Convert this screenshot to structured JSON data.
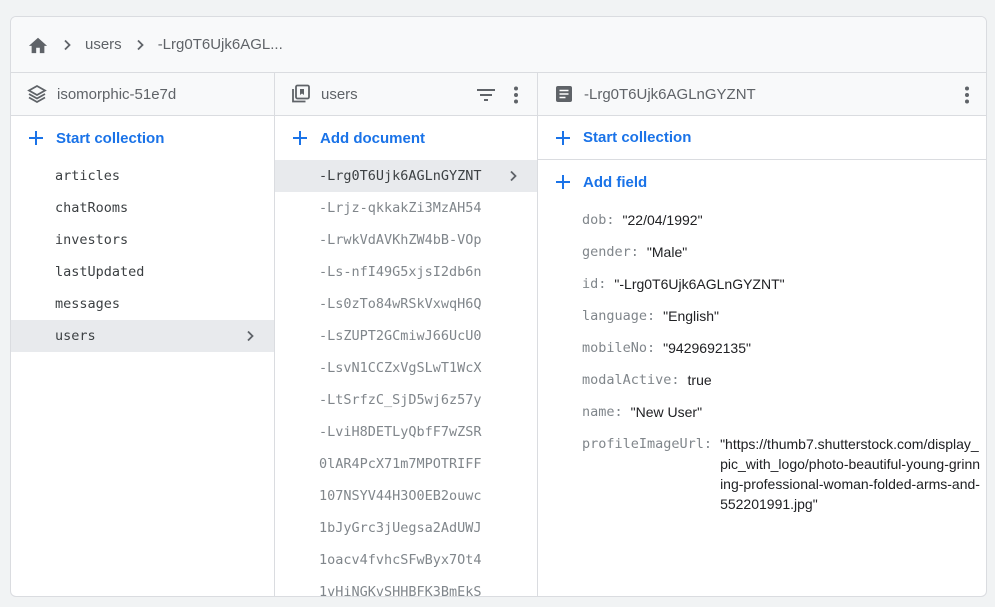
{
  "breadcrumb": {
    "items": [
      "users",
      "-Lrg0T6Ujk6AGL..."
    ]
  },
  "projects_panel": {
    "title": "isomorphic-51e7d",
    "add_label": "Start collection",
    "collections": [
      {
        "label": "articles"
      },
      {
        "label": "chatRooms"
      },
      {
        "label": "investors"
      },
      {
        "label": "lastUpdated"
      },
      {
        "label": "messages"
      },
      {
        "label": "users",
        "selected": true
      }
    ]
  },
  "collection_panel": {
    "title": "users",
    "add_label": "Add document",
    "documents": [
      {
        "label": "-Lrg0T6Ujk6AGLnGYZNT",
        "selected": true
      },
      {
        "label": "-Lrjz-qkkakZi3MzAH54"
      },
      {
        "label": "-LrwkVdAVKhZW4bB-VOp"
      },
      {
        "label": "-Ls-nfI49G5xjsI2db6n"
      },
      {
        "label": "-Ls0zTo84wRSkVxwqH6Q"
      },
      {
        "label": "-LsZUPT2GCmiwJ66UcU0"
      },
      {
        "label": "-LsvN1CCZxVgSLwT1WcX"
      },
      {
        "label": "-LtSrfzC_SjD5wj6z57y"
      },
      {
        "label": "-LviH8DETLyQbfF7wZSR"
      },
      {
        "label": "0lAR4PcX71m7MPOTRIFF"
      },
      {
        "label": "107NSYV44H3O0EB2ouwc"
      },
      {
        "label": "1bJyGrc3jUegsa2AdUWJ"
      },
      {
        "label": "1oacv4fvhcSFwByx7Ot4"
      },
      {
        "label": "1vHiNGKvSHHBFK3BmEkS"
      }
    ]
  },
  "document_panel": {
    "title": "-Lrg0T6Ujk6AGLnGYZNT",
    "start_collection_label": "Start collection",
    "add_field_label": "Add field",
    "fields": [
      {
        "key": "dob",
        "value": "\"22/04/1992\""
      },
      {
        "key": "gender",
        "value": "\"Male\""
      },
      {
        "key": "id",
        "value": "\"-Lrg0T6Ujk6AGLnGYZNT\""
      },
      {
        "key": "language",
        "value": "\"English\""
      },
      {
        "key": "mobileNo",
        "value": "\"9429692135\""
      },
      {
        "key": "modalActive",
        "value": "true"
      },
      {
        "key": "name",
        "value": "\"New User\""
      },
      {
        "key": "profileImageUrl",
        "value": "\"https://thumb7.shutterstock.com/display_pic_with_logo/photo-beautiful-young-grinning-professional-woman-folded-arms-and-552201991.jpg\"",
        "wrap": true
      }
    ]
  },
  "colors": {
    "accent": "#1a73e8",
    "icon": "#5f6368",
    "selected_bg": "#e8eaed",
    "border": "#dadce0"
  }
}
